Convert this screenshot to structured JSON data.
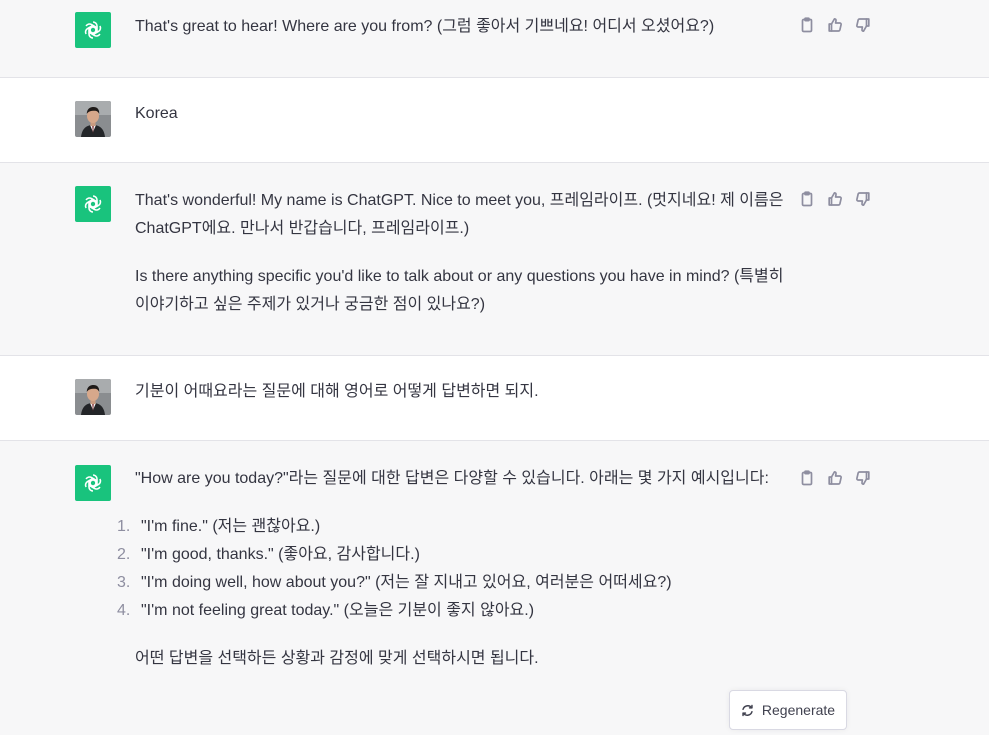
{
  "messages": [
    {
      "role": "assistant",
      "paragraphs": [
        "That's great to hear! Where are you from? (그럼 좋아서 기쁘네요! 어디서 오셨어요?)"
      ]
    },
    {
      "role": "user",
      "paragraphs": [
        "Korea"
      ]
    },
    {
      "role": "assistant",
      "paragraphs": [
        "That's wonderful! My name is ChatGPT. Nice to meet you, 프레임라이프. (멋지네요! 제 이름은 ChatGPT에요. 만나서 반갑습니다, 프레임라이프.)",
        "Is there anything specific you'd like to talk about or any questions you have in mind? (특별히 이야기하고 싶은 주제가 있거나 궁금한 점이 있나요?)"
      ]
    },
    {
      "role": "user",
      "paragraphs": [
        "기분이 어때요라는 질문에 대해 영어로 어떻게 답변하면 되지."
      ]
    },
    {
      "role": "assistant",
      "intro": "\"How are you today?\"라는 질문에 대한 답변은 다양할 수 있습니다. 아래는 몇 가지 예시입니다:",
      "list": [
        {
          "num": "1.",
          "text": "\"I'm fine.\" (저는 괜찮아요.)"
        },
        {
          "num": "2.",
          "text": "\"I'm good, thanks.\" (좋아요, 감사합니다.)"
        },
        {
          "num": "3.",
          "text": "\"I'm doing well, how about you?\" (저는 잘 지내고 있어요, 여러분은 어떠세요?)"
        },
        {
          "num": "4.",
          "text": "\"I'm not feeling great today.\" (오늘은 기분이 좋지 않아요.)"
        }
      ],
      "outro": "어떤 답변을 선택하든 상황과 감정에 맞게 선택하시면 됩니다."
    }
  ],
  "actions": {
    "copy_icon": "clipboard-icon",
    "like_icon": "thumbs-up-icon",
    "dislike_icon": "thumbs-down-icon"
  },
  "regenerate": {
    "label": "Regenerate",
    "icon": "refresh-icon"
  },
  "colors": {
    "assistant_bg": "#f7f7f8",
    "user_bg": "#ffffff",
    "gpt_avatar": "#19c37d",
    "text": "#343541",
    "icon_gray": "#8e8ea0"
  }
}
